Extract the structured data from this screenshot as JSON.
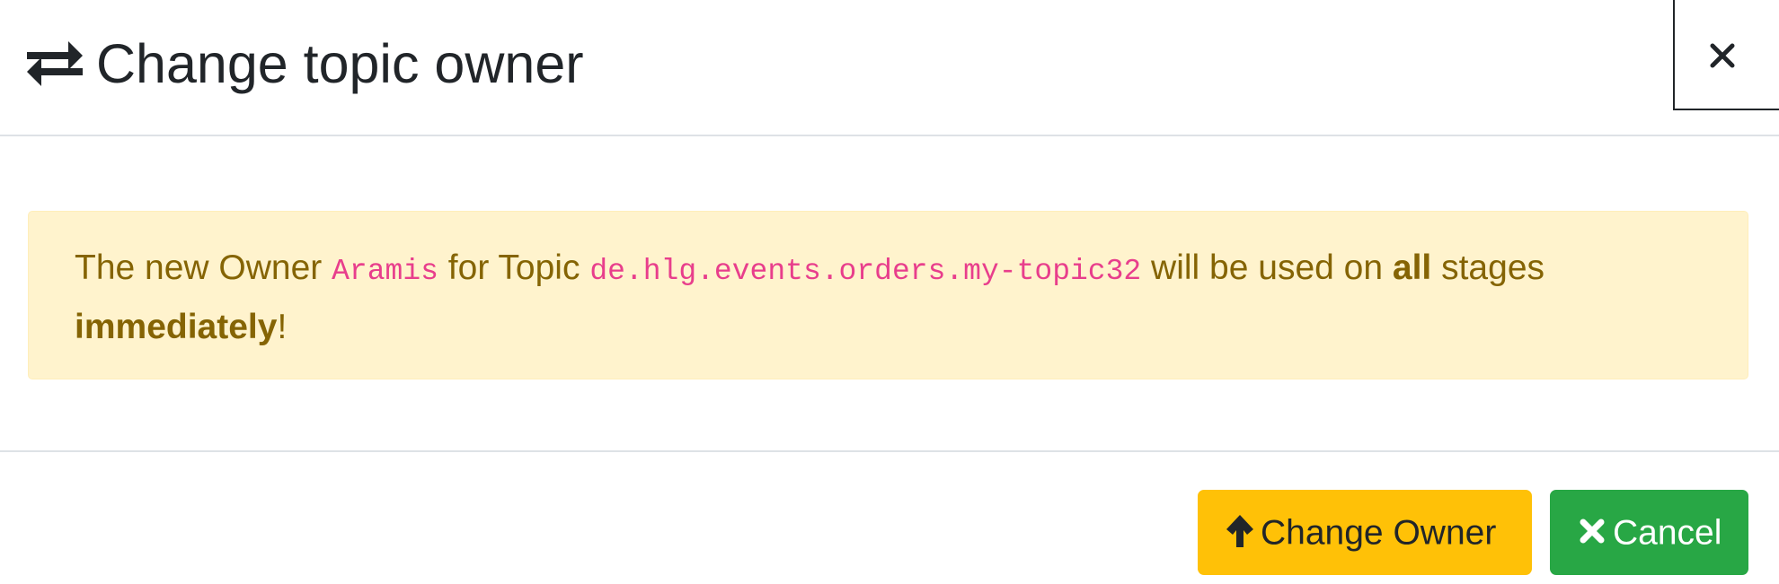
{
  "header": {
    "title": "Change topic owner",
    "title_icon": "exchange-arrows-icon",
    "close_icon": "close-icon"
  },
  "alert": {
    "text_before_owner": "The new Owner ",
    "owner": "Aramis",
    "text_before_topic": " for Topic ",
    "topic": "de.hlg.events.orders.my-topic32",
    "text_before_all": " will be used on ",
    "all": "all",
    "text_before_immediately": " stages ",
    "immediately": "immediately",
    "text_end": "!"
  },
  "footer": {
    "change_owner_label": "Change Owner",
    "change_owner_icon": "arrow-up-icon",
    "cancel_label": "Cancel",
    "cancel_icon": "times-icon"
  },
  "colors": {
    "alert_background": "#fff3cd",
    "alert_text": "#856404",
    "code_text": "#e83e8c",
    "warning_button": "#ffc107",
    "success_button": "#28a745"
  }
}
